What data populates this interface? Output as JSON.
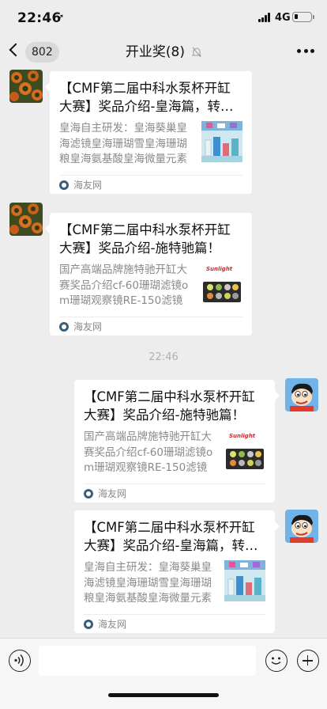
{
  "status_bar": {
    "time": "22:46",
    "location_glyph": "➚",
    "network": "4G",
    "battery_level": 0.2
  },
  "nav": {
    "unread_count": "802",
    "title": "开业奖(8)",
    "icons": {
      "back": "chevron-left-icon",
      "mute": "bell-slash-icon",
      "more": "more-dots-icon"
    }
  },
  "messages": [
    {
      "sender": "other",
      "title": "【CMF第二届中科水泵杯开缸大赛】奖品介绍-皇海篇，转发有奖！",
      "desc": "皇海自主研发：皇海葵巢皇海滤镜皇海珊瑚雪皇海珊瑚粮皇海氨基酸皇海微量元素",
      "source": "海友网",
      "thumb": "product-photo"
    },
    {
      "sender": "other",
      "title": "【CMF第二届中科水泵杯开缸大赛】奖品介绍-施特驰篇！",
      "desc": "国产高端品牌施特驰开缸大赛奖品介绍cf-60珊瑚滤镜om珊瑚观察镜RE-150滤镜",
      "source": "海友网",
      "thumb": "filter-lens-photo",
      "thumb_brand": "Sunlight"
    },
    {
      "sender": "self",
      "title": "【CMF第二届中科水泵杯开缸大赛】奖品介绍-施特驰篇！",
      "desc": "国产高端品牌施特驰开缸大赛奖品介绍cf-60珊瑚滤镜om珊瑚观察镜RE-150滤镜",
      "source": "海友网",
      "thumb": "filter-lens-photo",
      "thumb_brand": "Sunlight"
    },
    {
      "sender": "self",
      "title": "【CMF第二届中科水泵杯开缸大赛】奖品介绍-皇海篇，转发有奖！",
      "desc": "皇海自主研发：皇海葵巢皇海滤镜皇海珊瑚雪皇海珊瑚粮皇海氨基酸皇海微量元素",
      "source": "海友网",
      "thumb": "product-photo"
    }
  ],
  "timestamp": "22:46",
  "input_bar": {
    "placeholder": "",
    "icons": {
      "voice": "voice-icon",
      "emoji": "emoji-icon",
      "plus": "plus-icon"
    }
  },
  "colors": {
    "background": "#ededed",
    "bubble": "#ffffff",
    "muted_text": "#8a8a8a"
  }
}
